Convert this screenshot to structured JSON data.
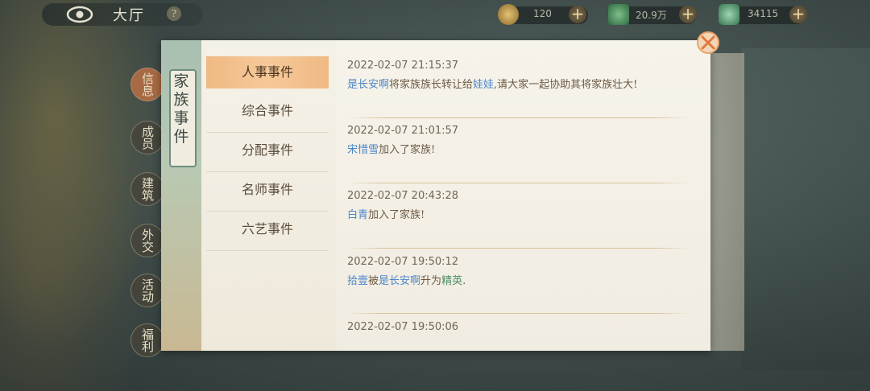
{
  "header": {
    "title": "大厅",
    "help_symbol": "?",
    "resources": [
      {
        "icon": "coin-icon",
        "value": "120",
        "color": "#b98e3a"
      },
      {
        "icon": "silver-icon",
        "value": "20.9万",
        "color": "#3f8a58"
      },
      {
        "icon": "jade-icon",
        "value": "34115",
        "color": "#4f9a72"
      }
    ],
    "plus_symbol": "+"
  },
  "side_menu": [
    {
      "label": "信息",
      "active": true
    },
    {
      "label": "成员",
      "active": false
    },
    {
      "label": "建筑",
      "active": false
    },
    {
      "label": "外交",
      "active": false
    },
    {
      "label": "活动",
      "active": false
    },
    {
      "label": "福利",
      "active": false
    }
  ],
  "panel": {
    "title": "家族事件",
    "tabs": [
      {
        "label": "人事事件",
        "active": true
      },
      {
        "label": "综合事件",
        "active": false
      },
      {
        "label": "分配事件",
        "active": false
      },
      {
        "label": "名师事件",
        "active": false
      },
      {
        "label": "六艺事件",
        "active": false
      }
    ],
    "events": [
      {
        "time": "2022-02-07  21:15:37",
        "parts": [
          {
            "t": "是长安啊",
            "c": "name"
          },
          {
            "t": "将家族族长转让给",
            "c": ""
          },
          {
            "t": "娃娃",
            "c": "name"
          },
          {
            "t": ",请大家一起协助其将家族壮大!",
            "c": ""
          }
        ]
      },
      {
        "time": "2022-02-07  21:01:57",
        "parts": [
          {
            "t": "宋惜雪",
            "c": "name"
          },
          {
            "t": "加入了家族!",
            "c": ""
          }
        ]
      },
      {
        "time": "2022-02-07  20:43:28",
        "parts": [
          {
            "t": "白青",
            "c": "name"
          },
          {
            "t": "加入了家族!",
            "c": ""
          }
        ]
      },
      {
        "time": "2022-02-07  19:50:12",
        "parts": [
          {
            "t": "拾壹",
            "c": "name"
          },
          {
            "t": "被",
            "c": ""
          },
          {
            "t": "是长安啊",
            "c": "name"
          },
          {
            "t": "升为",
            "c": ""
          },
          {
            "t": "精英",
            "c": "rank"
          },
          {
            "t": ".",
            "c": ""
          }
        ]
      },
      {
        "time": "2022-02-07  19:50:06",
        "parts": []
      }
    ]
  },
  "colors": {
    "name_blue": "#4c86c8",
    "rank_green": "#4f8f66",
    "active_tab": "#f6c99a"
  }
}
